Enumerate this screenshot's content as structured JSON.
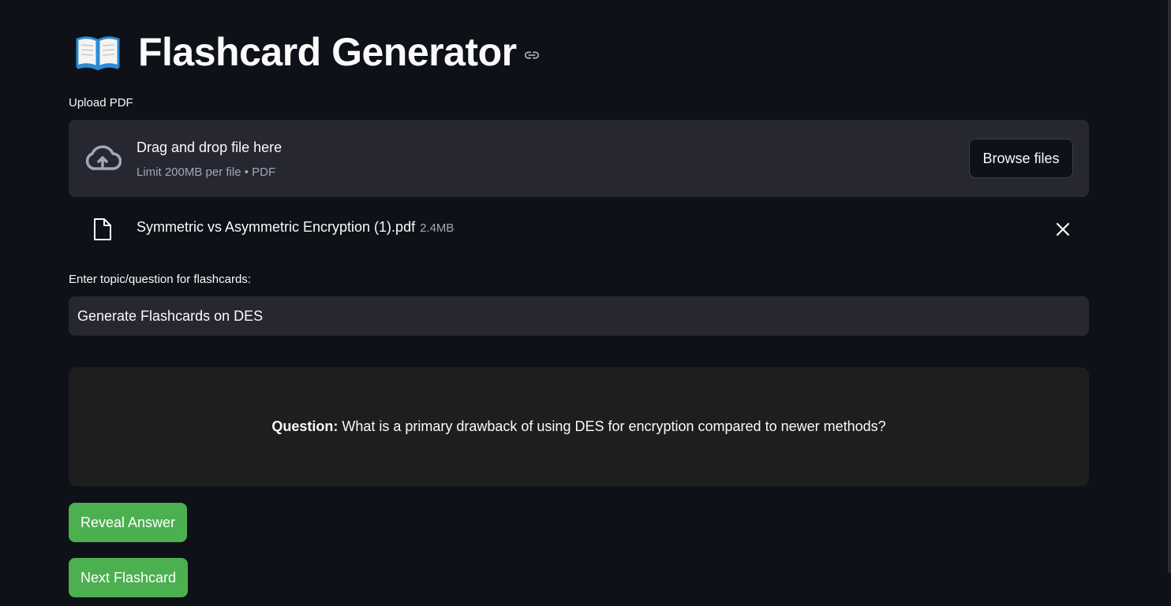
{
  "header": {
    "title": "Flashcard Generator",
    "title_icon": "open-book-icon",
    "anchor_icon": "link-icon"
  },
  "uploader": {
    "label": "Upload PDF",
    "drop_title": "Drag and drop file here",
    "drop_subtitle": "Limit 200MB per file • PDF",
    "browse_label": "Browse files",
    "icon": "cloud-upload-icon"
  },
  "uploaded_file": {
    "name": "Symmetric vs Asymmetric Encryption (1).pdf",
    "size": "2.4MB",
    "icon": "file-icon",
    "remove_icon": "close-icon"
  },
  "topic_input": {
    "label": "Enter topic/question for flashcards:",
    "value": "Generate Flashcards on DES"
  },
  "flashcard": {
    "question_label": "Question:",
    "question_text": " What is a primary drawback of using DES for encryption compared to newer methods?"
  },
  "actions": {
    "reveal_label": "Reveal Answer",
    "next_label": "Next Flashcard"
  },
  "colors": {
    "background": "#0e1117",
    "surface": "#262730",
    "card": "#1e1e1e",
    "accent_green": "#4caf50",
    "muted_text": "#a3a8b8"
  }
}
